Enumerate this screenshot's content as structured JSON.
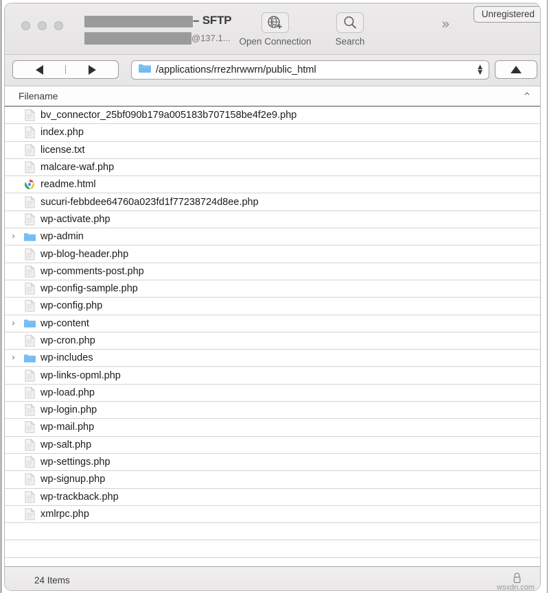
{
  "window": {
    "title_suffix": "– SFTP",
    "host": "@137.1...",
    "unregistered_label": "Unregistered",
    "overflow_icon": "chevrons-right-icon"
  },
  "toolbar": {
    "items": [
      {
        "label": "Open Connection",
        "icon": "globe-plus-icon"
      },
      {
        "label": "Search",
        "icon": "search-icon"
      }
    ]
  },
  "navbar": {
    "back_icon": "triangle-left-icon",
    "forward_icon": "triangle-right-icon",
    "up_icon": "triangle-up-icon",
    "path": "/applications/rrezhrwwrn/public_html",
    "path_icon": "folder-icon",
    "stepper_icon": "up-down-chevron-icon"
  },
  "list": {
    "column_header": "Filename",
    "sort_indicator": "chevron-up-icon",
    "rows": [
      {
        "name": "bv_connector_25bf090b179a005183b707158be4f2e9.php",
        "type": "file",
        "icon": "document-icon",
        "expandable": false
      },
      {
        "name": "index.php",
        "type": "file",
        "icon": "document-icon",
        "expandable": false
      },
      {
        "name": "license.txt",
        "type": "file",
        "icon": "document-icon",
        "expandable": false
      },
      {
        "name": "malcare-waf.php",
        "type": "file",
        "icon": "document-icon",
        "expandable": false
      },
      {
        "name": "readme.html",
        "type": "file",
        "icon": "browser-document-icon",
        "expandable": false
      },
      {
        "name": "sucuri-febbdee64760a023fd1f77238724d8ee.php",
        "type": "file",
        "icon": "document-icon",
        "expandable": false
      },
      {
        "name": "wp-activate.php",
        "type": "file",
        "icon": "document-icon",
        "expandable": false
      },
      {
        "name": "wp-admin",
        "type": "folder",
        "icon": "folder-icon",
        "expandable": true
      },
      {
        "name": "wp-blog-header.php",
        "type": "file",
        "icon": "document-icon",
        "expandable": false
      },
      {
        "name": "wp-comments-post.php",
        "type": "file",
        "icon": "document-icon",
        "expandable": false
      },
      {
        "name": "wp-config-sample.php",
        "type": "file",
        "icon": "document-icon",
        "expandable": false
      },
      {
        "name": "wp-config.php",
        "type": "file",
        "icon": "document-icon",
        "expandable": false
      },
      {
        "name": "wp-content",
        "type": "folder",
        "icon": "folder-icon",
        "expandable": true
      },
      {
        "name": "wp-cron.php",
        "type": "file",
        "icon": "document-icon",
        "expandable": false
      },
      {
        "name": "wp-includes",
        "type": "folder",
        "icon": "folder-icon",
        "expandable": true
      },
      {
        "name": "wp-links-opml.php",
        "type": "file",
        "icon": "document-icon",
        "expandable": false
      },
      {
        "name": "wp-load.php",
        "type": "file",
        "icon": "document-icon",
        "expandable": false
      },
      {
        "name": "wp-login.php",
        "type": "file",
        "icon": "document-icon",
        "expandable": false
      },
      {
        "name": "wp-mail.php",
        "type": "file",
        "icon": "document-icon",
        "expandable": false
      },
      {
        "name": "wp-salt.php",
        "type": "file",
        "icon": "document-icon",
        "expandable": false
      },
      {
        "name": "wp-settings.php",
        "type": "file",
        "icon": "document-icon",
        "expandable": false
      },
      {
        "name": "wp-signup.php",
        "type": "file",
        "icon": "document-icon",
        "expandable": false
      },
      {
        "name": "wp-trackback.php",
        "type": "file",
        "icon": "document-icon",
        "expandable": false
      },
      {
        "name": "xmlrpc.php",
        "type": "file",
        "icon": "document-icon",
        "expandable": false
      }
    ],
    "empty_row_count": 2,
    "disclosure_glyph": "›"
  },
  "status": {
    "item_count_label": "24 Items",
    "lock_icon": "padlock-icon",
    "watermark": "wsxdn.com"
  },
  "colors": {
    "folder_blue": "#74bdf0",
    "titlebar_gray": "#ebe9e9",
    "row_divider": "#d3d3d3",
    "text_primary": "#1a1a1a"
  }
}
